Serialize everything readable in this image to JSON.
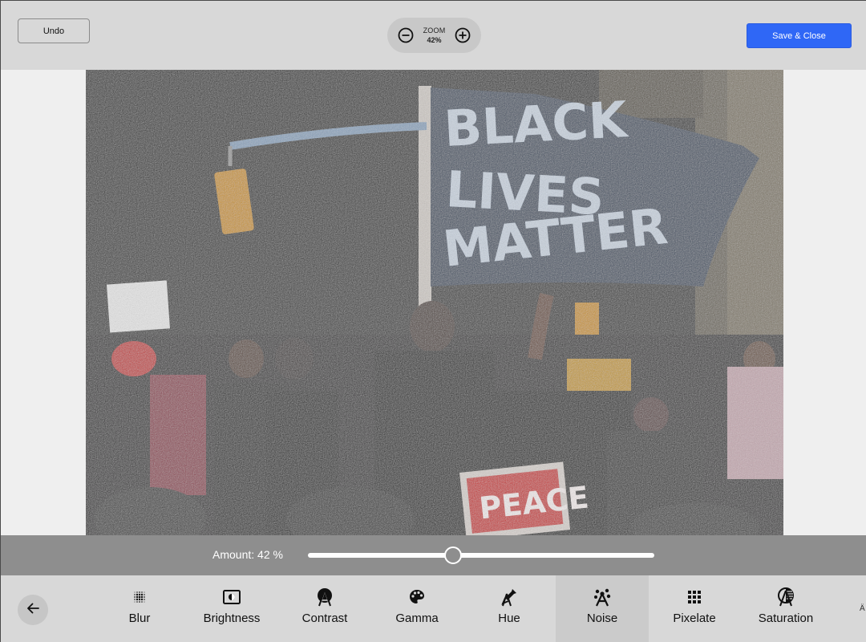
{
  "toolbar": {
    "undo_label": "Undo",
    "zoom": {
      "label": "ZOOM",
      "value": "42%",
      "zoom_out_icon": "minus-circle-icon",
      "zoom_in_icon": "plus-circle-icon"
    },
    "save_label": "Save & Close",
    "accent_color": "#2f67f6"
  },
  "canvas": {
    "image_alt": "Protest photo with Black Lives Matter flag, noise filter applied",
    "flag_text": [
      "BLACK",
      "LIVES",
      "MATTER"
    ],
    "sign_text": "PEACE"
  },
  "amount": {
    "label": "Amount: 42 %",
    "value": 42,
    "min": 0,
    "max": 100
  },
  "tools": {
    "back_icon": "arrow-left-icon",
    "items": [
      {
        "label": "Blur",
        "icon": "blur-dots-icon",
        "active": false
      },
      {
        "label": "Brightness",
        "icon": "brightness-icon",
        "active": false
      },
      {
        "label": "Contrast",
        "icon": "contrast-icon",
        "active": false
      },
      {
        "label": "Gamma",
        "icon": "palette-icon",
        "active": false
      },
      {
        "label": "Hue",
        "icon": "eyedropper-icon",
        "active": false
      },
      {
        "label": "Noise",
        "icon": "noise-icon",
        "active": true
      },
      {
        "label": "Pixelate",
        "icon": "pixel-grid-icon",
        "active": false
      },
      {
        "label": "Saturation",
        "icon": "saturation-icon",
        "active": false
      }
    ],
    "overflow_glyph": "Ä"
  }
}
